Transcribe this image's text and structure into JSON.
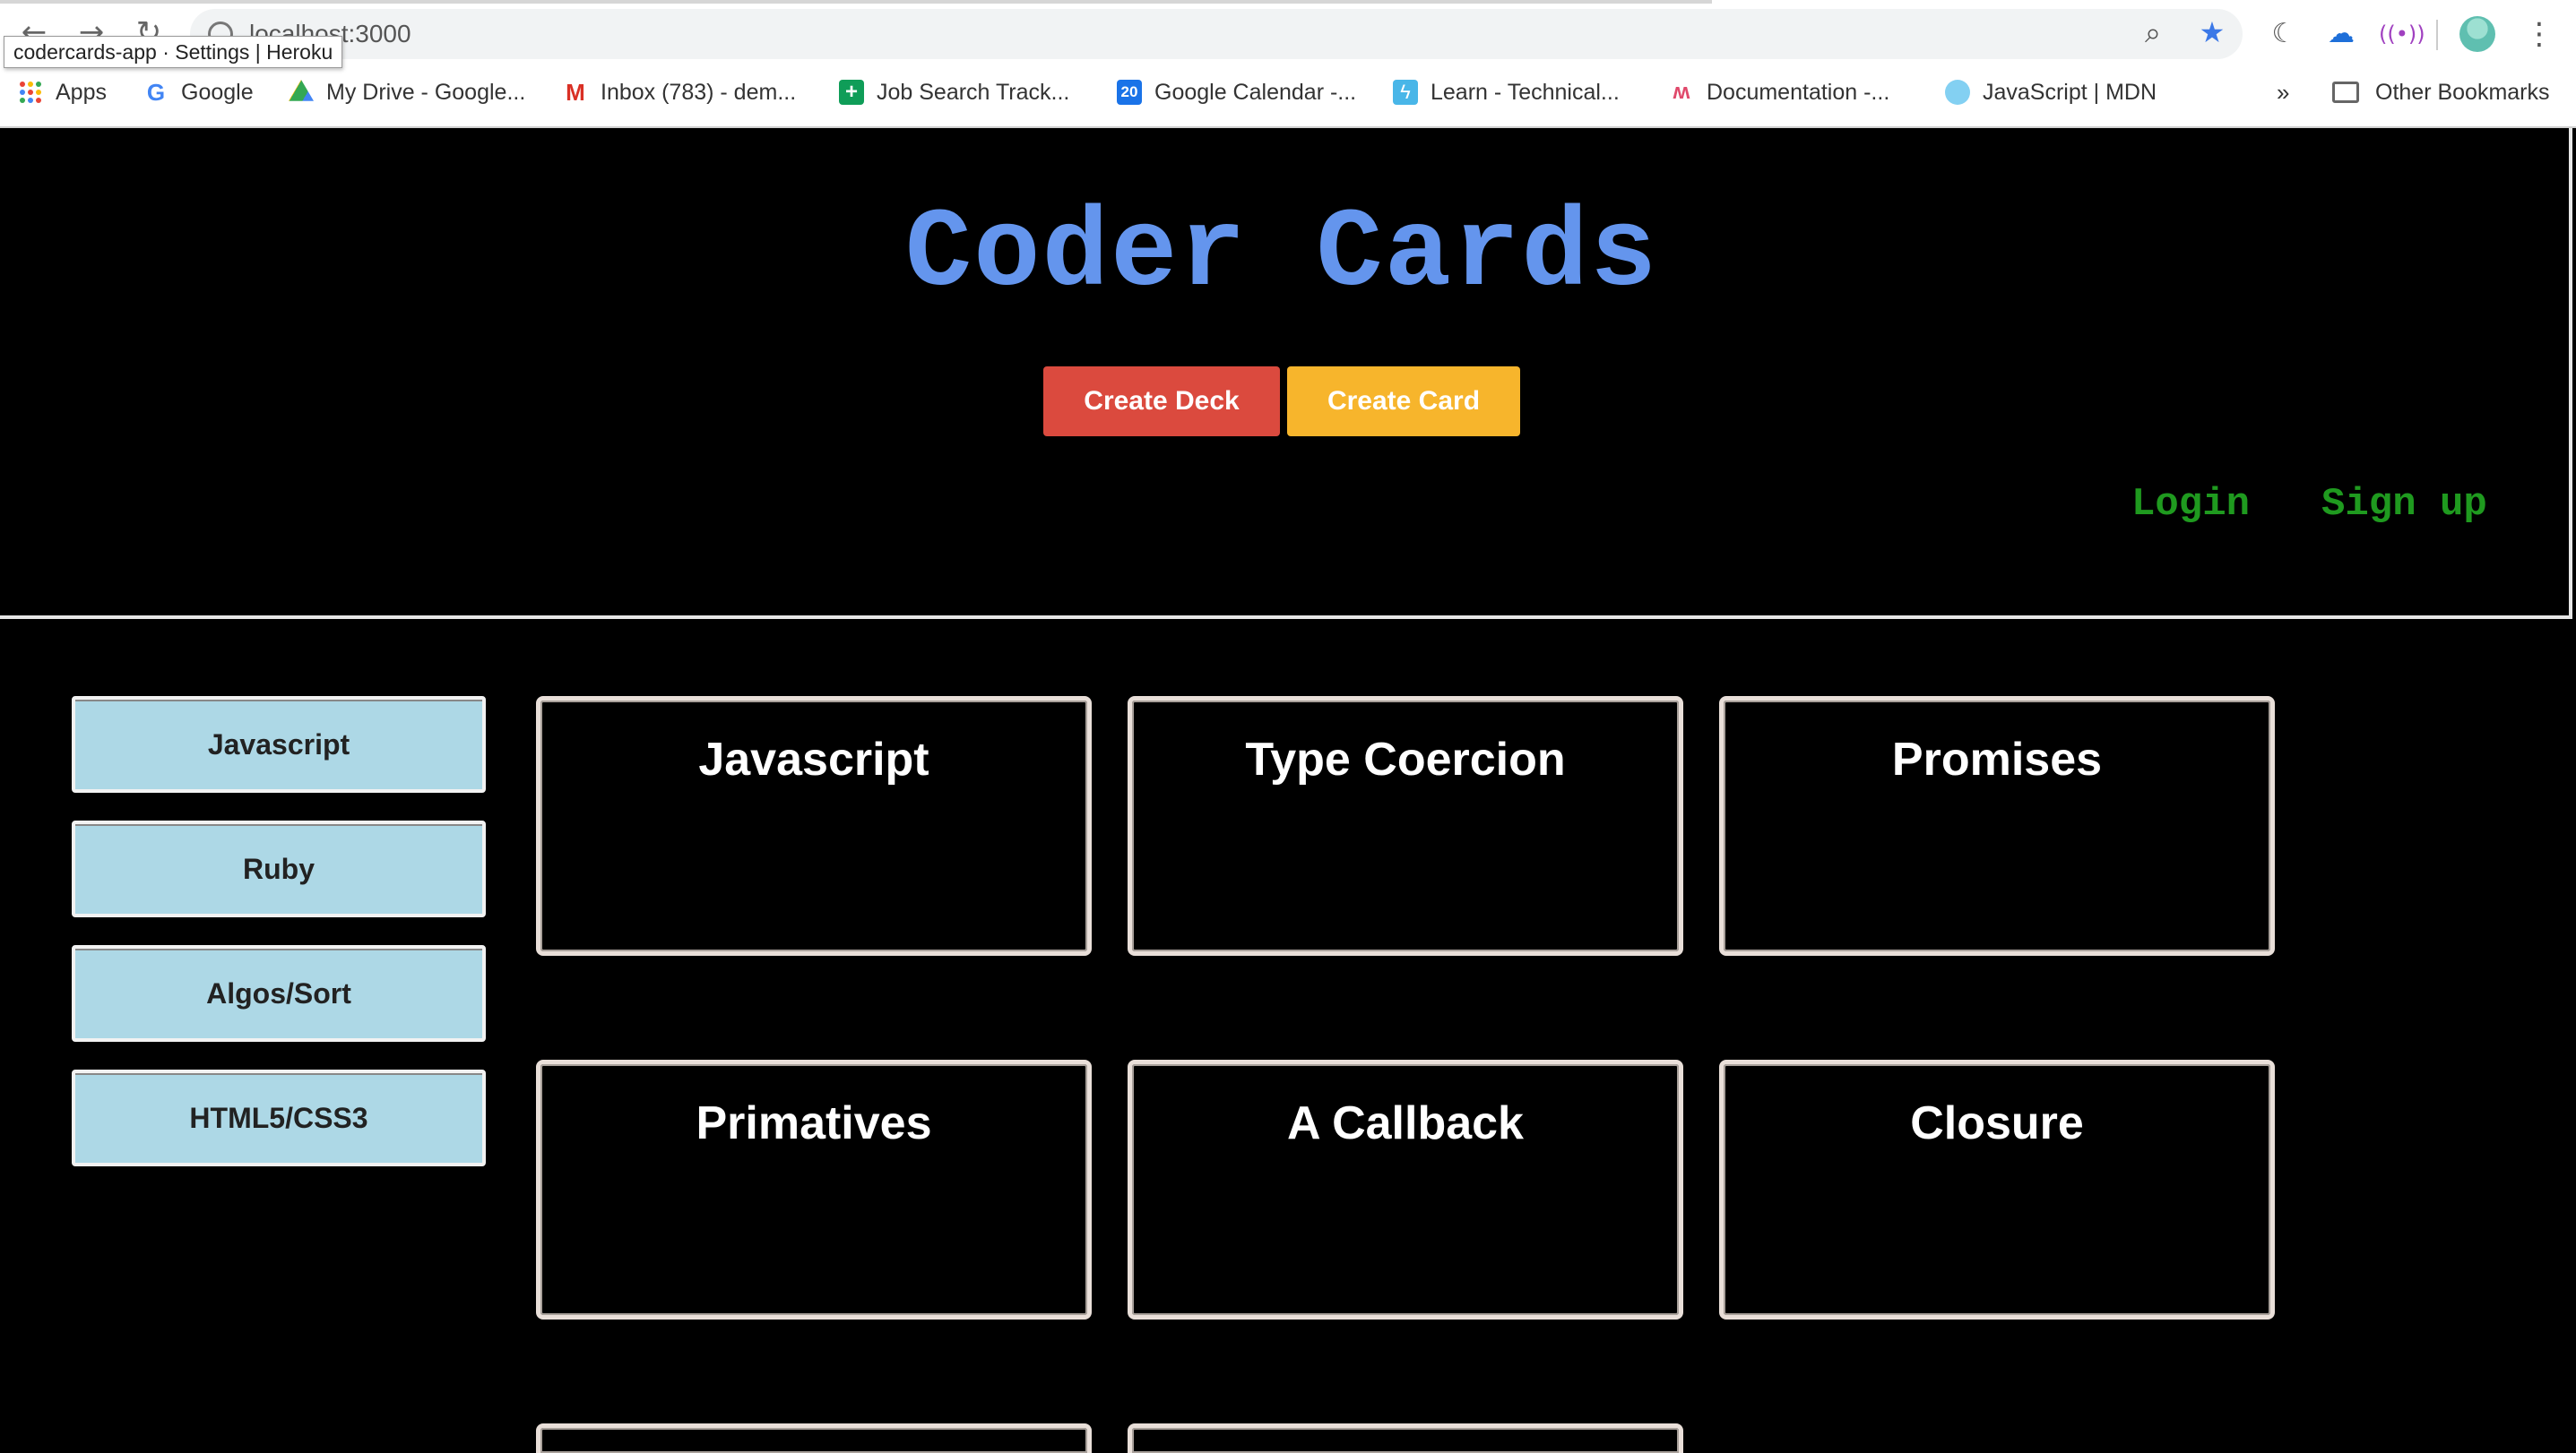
{
  "browser": {
    "url": "localhost:3000",
    "tooltip": "codercards-app · Settings | Heroku",
    "bookmarks": [
      {
        "label": "Apps",
        "icon": "apps-grid-icon"
      },
      {
        "label": "Google",
        "icon": "google-icon"
      },
      {
        "label": "My Drive - Google...",
        "icon": "drive-icon"
      },
      {
        "label": "Inbox (783) - dem...",
        "icon": "gmail-icon"
      },
      {
        "label": "Job Search Track...",
        "icon": "sheets-icon"
      },
      {
        "label": "Google Calendar -...",
        "icon": "calendar-icon"
      },
      {
        "label": "Learn - Technical...",
        "icon": "learn-icon"
      },
      {
        "label": "Documentation -...",
        "icon": "docs-icon"
      },
      {
        "label": "JavaScript | MDN",
        "icon": "mdn-icon"
      }
    ],
    "overflow": "»",
    "other_bookmarks": "Other Bookmarks",
    "calendar_day": "20"
  },
  "header": {
    "title": "Coder Cards",
    "create_deck": "Create Deck",
    "create_card": "Create Card",
    "login": "Login",
    "signup": "Sign up"
  },
  "sidebar": {
    "decks": [
      "Javascript",
      "Ruby",
      "Algos/Sort",
      "HTML5/CSS3"
    ]
  },
  "cards": [
    "Javascript",
    "Type Coercion",
    "Promises",
    "Primatives",
    "A Callback",
    "Closure"
  ],
  "colors": {
    "title": "#6495ed",
    "create_deck": "#db4a3e",
    "create_card": "#f7b52c",
    "auth_links": "#1f9a1f",
    "sidebar_button": "#add8e6"
  }
}
